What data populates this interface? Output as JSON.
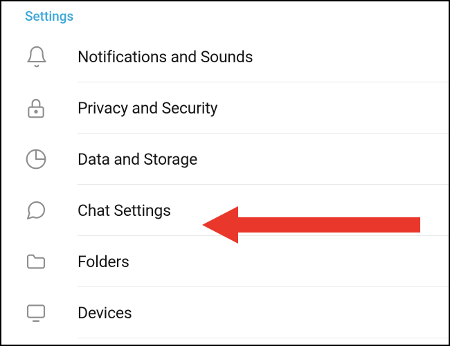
{
  "section_title": "Settings",
  "items": [
    {
      "id": "notifications",
      "label": "Notifications and Sounds",
      "icon": "bell-icon"
    },
    {
      "id": "privacy",
      "label": "Privacy and Security",
      "icon": "lock-icon"
    },
    {
      "id": "data",
      "label": "Data and Storage",
      "icon": "pie-icon"
    },
    {
      "id": "chat",
      "label": "Chat Settings",
      "icon": "chat-icon"
    },
    {
      "id": "folders",
      "label": "Folders",
      "icon": "folder-icon"
    },
    {
      "id": "devices",
      "label": "Devices",
      "icon": "devices-icon"
    }
  ],
  "annotation": {
    "type": "arrow",
    "target": "chat",
    "color": "#e9372b"
  }
}
